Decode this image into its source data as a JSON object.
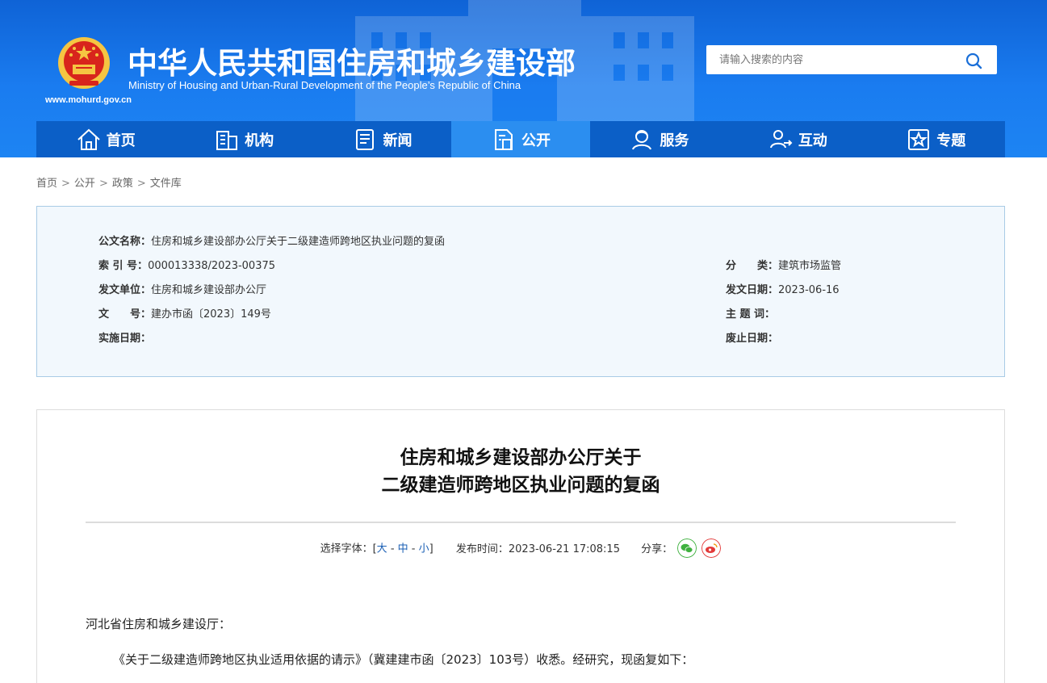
{
  "header": {
    "site_title": "中华人民共和国住房和城乡建设部",
    "site_subtitle": "Ministry of Housing and Urban-Rural Development of the People’s Republic of China",
    "site_url": "www.mohurd.gov.cn",
    "emblem_icon": "national-emblem-icon",
    "search": {
      "placeholder": "请输入搜索的内容",
      "icon": "search-icon"
    }
  },
  "nav": {
    "items": [
      {
        "label": "首页",
        "icon": "home-icon",
        "active": false
      },
      {
        "label": "机构",
        "icon": "building-icon",
        "active": false
      },
      {
        "label": "新闻",
        "icon": "news-icon",
        "active": false
      },
      {
        "label": "公开",
        "icon": "document-icon",
        "active": true
      },
      {
        "label": "服务",
        "icon": "service-icon",
        "active": false
      },
      {
        "label": "互动",
        "icon": "interaction-icon",
        "active": false
      },
      {
        "label": "专题",
        "icon": "star-icon",
        "active": false
      }
    ]
  },
  "breadcrumb": [
    "首页",
    "公开",
    "政策",
    "文件库"
  ],
  "meta": {
    "title_label": "公文名称：",
    "title_value": "住房和城乡建设部办公厅关于二级建造师跨地区执业问题的复函",
    "index_label": "索 引 号：",
    "index_value": "000013338/2023-00375",
    "category_label": "分　　类：",
    "category_value": "建筑市场监管",
    "issuer_label": "发文单位：",
    "issuer_value": "住房和城乡建设部办公厅",
    "issue_date_label": "发文日期：",
    "issue_date_value": "2023-06-16",
    "doc_no_label": "文　　号：",
    "doc_no_value": "建办市函〔2023〕149号",
    "keywords_label": "主 题 词：",
    "keywords_value": "",
    "effective_label": "实施日期：",
    "effective_value": "",
    "expire_label": "废止日期：",
    "expire_value": ""
  },
  "article": {
    "title_line1": "住房和城乡建设部办公厅关于",
    "title_line2": "二级建造师跨地区执业问题的复函",
    "font_select_label": "选择字体：[",
    "font_large": "大",
    "font_medium": "中",
    "font_small": "小",
    "font_select_end": "]",
    "publish_label": "发布时间：",
    "publish_time": "2023-06-21 17:08:15",
    "share_label": "分享：",
    "salutation": "河北省住房和城乡建设厅：",
    "paragraph1": "《关于二级建造师跨地区执业适用依据的请示》（冀建建市函〔2023〕103号）收悉。经研究，现函复如下："
  },
  "colors": {
    "header_blue": "#1a7cf0",
    "nav_blue": "#0b5fc7",
    "nav_active": "#2b8ef0",
    "meta_bg": "#f2f8fd",
    "link_blue": "#1a5fb4"
  }
}
